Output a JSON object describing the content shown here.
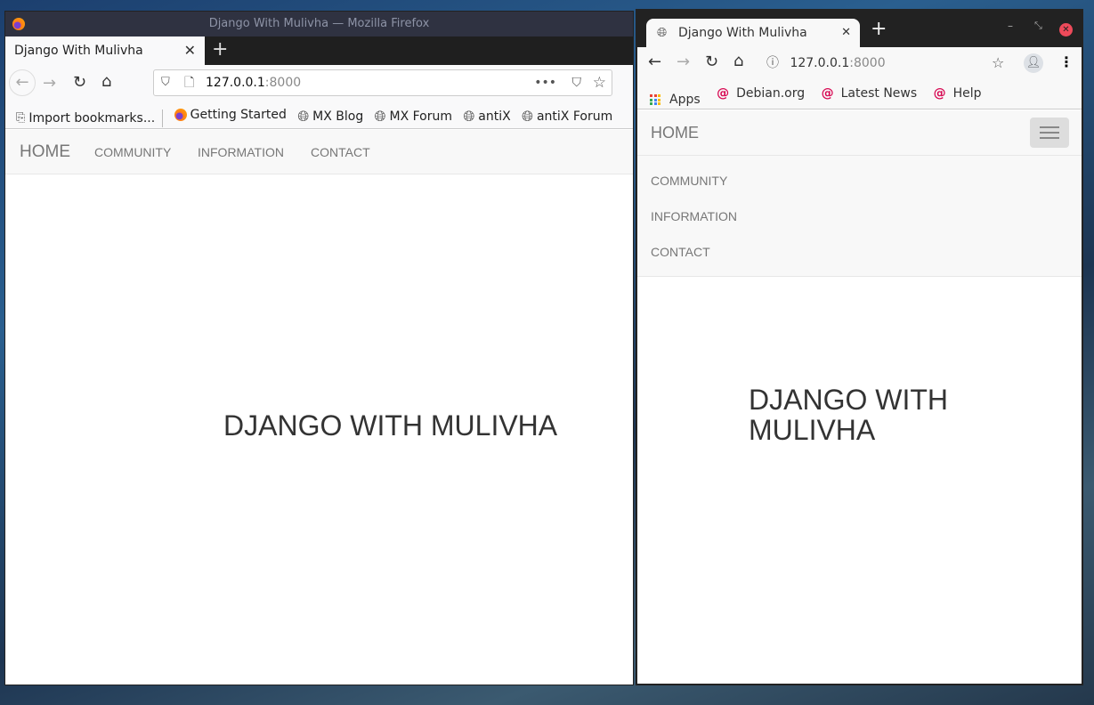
{
  "firefox": {
    "window_title": "Django With Mulivha — Mozilla Firefox",
    "tab_title": "Django With Mulivha",
    "url_host": "127.0.0.1",
    "url_port": ":8000",
    "bookmarks": [
      "Import bookmarks...",
      "Getting Started",
      "MX Blog",
      "MX Forum",
      "antiX",
      "antiX Forum"
    ]
  },
  "chrome": {
    "tab_title": "Django With Mulivha",
    "url_host": "127.0.0.1",
    "url_port": ":8000",
    "bookmarks": [
      "Apps",
      "Debian.org",
      "Latest News",
      "Help"
    ]
  },
  "site": {
    "brand": "HOME",
    "nav": [
      "COMMUNITY",
      "INFORMATION",
      "CONTACT"
    ],
    "heading": "DJANGO WITH MULIVHA",
    "heading_line1": "DJANGO WITH",
    "heading_line2": "MULIVHA"
  }
}
